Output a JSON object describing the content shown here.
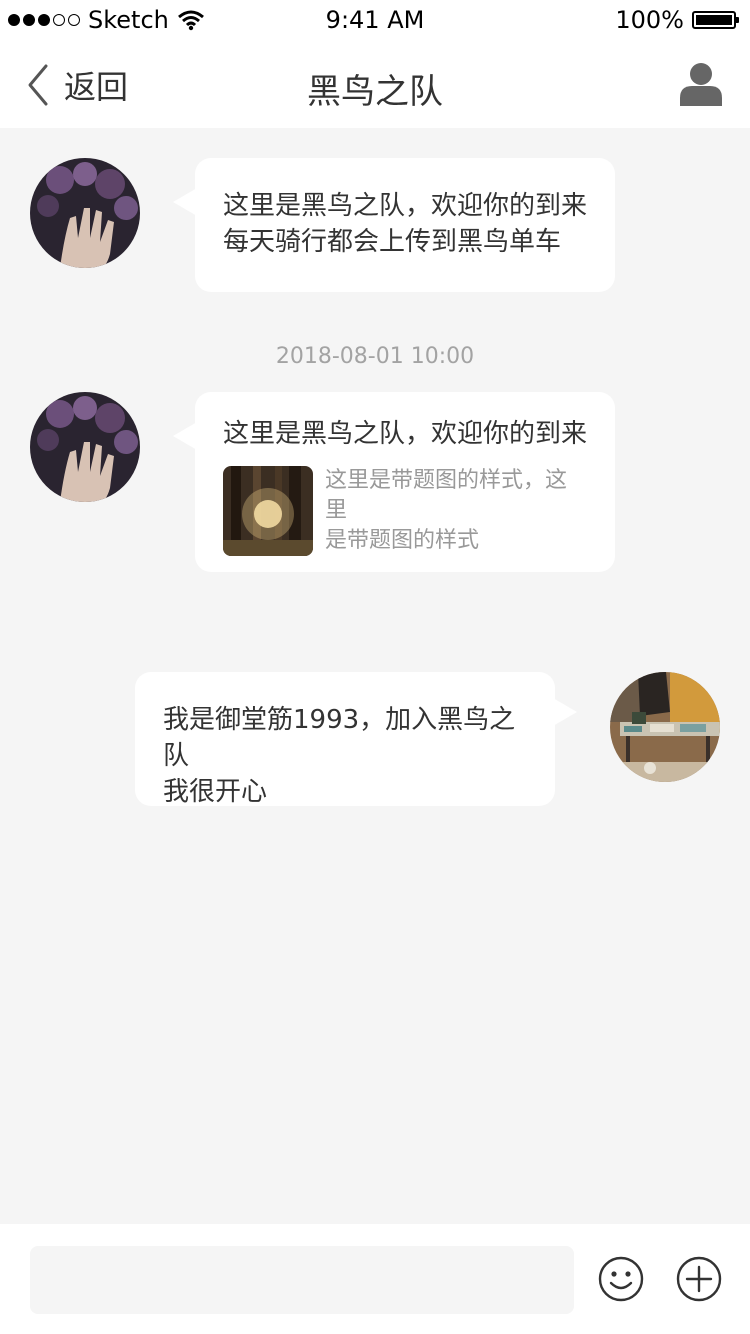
{
  "status_bar": {
    "carrier": "Sketch",
    "time": "9:41 AM",
    "battery": "100%"
  },
  "nav": {
    "back_label": "返回",
    "title": "黑鸟之队"
  },
  "messages": [
    {
      "side": "left",
      "lines": [
        "这里是黑鸟之队，欢迎你的到来",
        "每天骑行都会上传到黑鸟单车"
      ]
    },
    {
      "side": "left",
      "text": "这里是黑鸟之队，欢迎你的到来",
      "card": {
        "lines": [
          "这里是带题图的样式，这里",
          "是带题图的样式"
        ]
      }
    },
    {
      "side": "right",
      "lines": [
        "我是御堂筋1993，加入黑鸟之队",
        "我很开心"
      ]
    }
  ],
  "timestamp": "2018-08-01 10:00",
  "input": {
    "placeholder": ""
  },
  "icons": {
    "back": "chevron-left-icon",
    "profile": "user-icon",
    "emoji": "smiley-icon",
    "add": "plus-circle-icon"
  },
  "colors": {
    "background": "#f5f5f5",
    "bubble": "#ffffff",
    "text": "#333333",
    "muted": "#999999"
  }
}
